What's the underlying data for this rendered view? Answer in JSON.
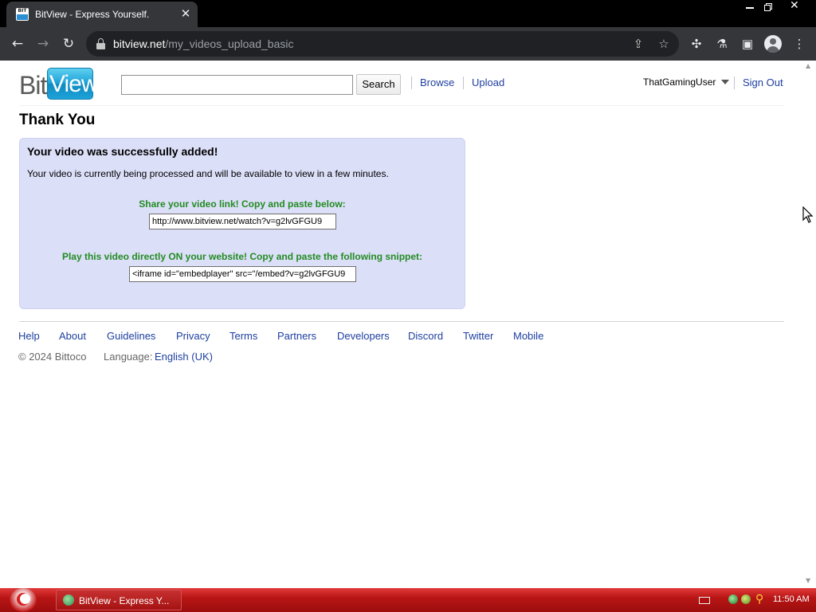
{
  "browser": {
    "tab": {
      "title": "BitView - Express Yourself.",
      "favicon_text": "BIT"
    },
    "close_tab_glyph": "✕",
    "url": {
      "host": "bitview.net",
      "path": "/my_videos_upload_basic"
    },
    "icons": [
      "back-icon",
      "forward-icon",
      "reload-icon",
      "lock-icon",
      "share-icon",
      "star-icon",
      "extensions-icon",
      "labs-icon",
      "sidepanel-icon",
      "profile-icon",
      "menu-icon"
    ]
  },
  "site": {
    "logo": {
      "part1": "Bit",
      "part2": "View"
    },
    "search": {
      "value": "",
      "button": "Search"
    },
    "nav": {
      "browse": "Browse",
      "upload": "Upload"
    },
    "user": {
      "name": "ThatGamingUser",
      "sign_out": "Sign Out"
    }
  },
  "page": {
    "title": "Thank You",
    "success": {
      "heading": "Your video was successfully added!",
      "message": "Your video is currently being processed and will be available to view in a few minutes.",
      "share_label": "Share your video link! Copy and paste below:",
      "share_value": "http://www.bitview.net/watch?v=g2lvGFGU9",
      "embed_label": "Play this video directly ON your website! Copy and paste the following snippet:",
      "embed_value": "<iframe id=\"embedplayer\" src=\"/embed?v=g2lvGFGU9"
    }
  },
  "footer": {
    "links": [
      "Help",
      "About",
      "Guidelines",
      "Privacy",
      "Terms",
      "Partners",
      "Developers",
      "Discord",
      "Twitter",
      "Mobile"
    ],
    "copyright": "© 2024 Bittoco",
    "language_label": "Language:",
    "language_value": "English (UK)"
  },
  "taskbar": {
    "task_label": "BitView - Express Y...",
    "clock": "11:50 AM"
  },
  "colors": {
    "link": "#1e3fa0",
    "success_bg": "#dcdff8",
    "success_label": "#228b22",
    "taskbar": "#b81515"
  }
}
